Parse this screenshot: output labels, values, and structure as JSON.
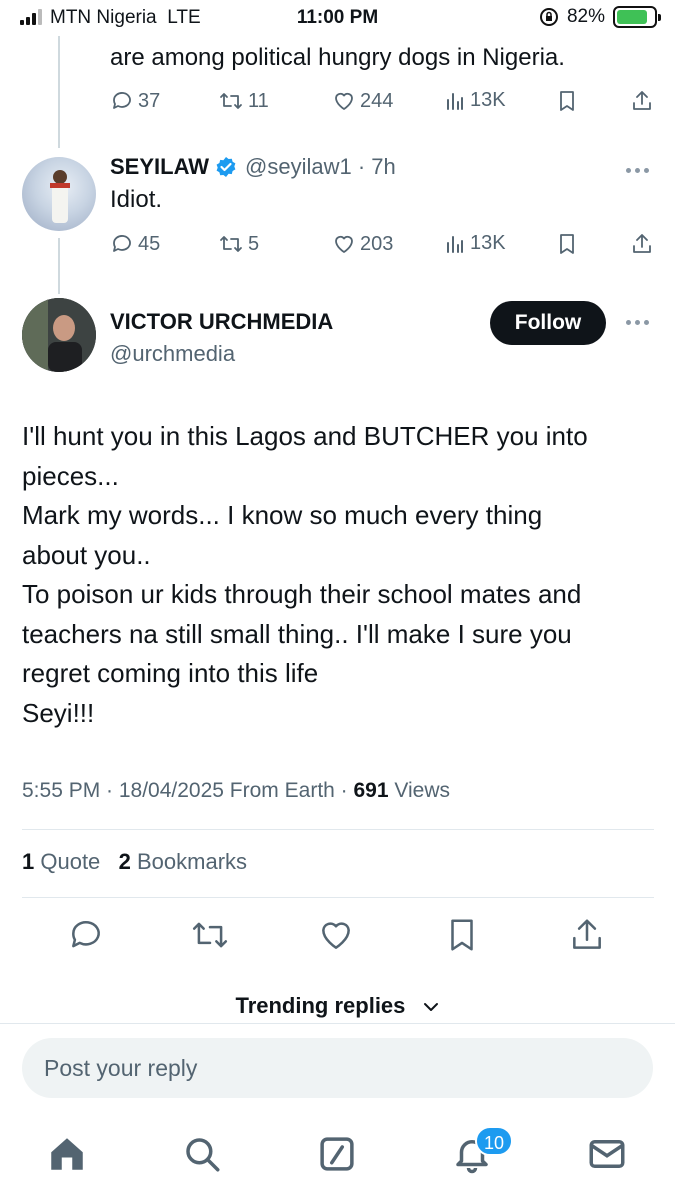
{
  "status_bar": {
    "carrier": "MTN Nigeria",
    "network": "LTE",
    "time": "11:00 PM",
    "battery": "82%",
    "battery_level": 0.82
  },
  "previous_tweet": {
    "text_tail": "are among political hungry dogs in Nigeria.",
    "replies": "37",
    "reposts": "11",
    "likes": "244",
    "views": "13K"
  },
  "reply_tweet": {
    "name": "SEYILAW",
    "handle_meta": "@seyilaw1 · 7h",
    "text": "Idiot.",
    "replies": "45",
    "reposts": "5",
    "likes": "203",
    "views": "13K"
  },
  "main_tweet": {
    "name": "VICTOR URCHMEDIA",
    "handle": "@urchmedia",
    "follow_label": "Follow",
    "lines": [
      "I'll hunt you in this Lagos and BUTCHER you into",
      "pieces...",
      "Mark my words... I know so much every thing",
      "about you..",
      "To poison ur kids through their school mates and",
      "teachers na still small thing..  I'll make I sure you",
      "regret coming into this life",
      "Seyi!!!"
    ],
    "timestamp": "5:55 PM · 18/04/2025 From Earth · ",
    "views_count": "691",
    "views_label": " Views",
    "quotes_count": "1",
    "quotes_label": " Quote",
    "bookmarks_count": "2",
    "bookmarks_label": " Bookmarks"
  },
  "trending": {
    "label": "Trending replies"
  },
  "reply_box": {
    "placeholder": "Post your reply"
  },
  "tab_bar": {
    "notifications_badge": "10"
  },
  "colors": {
    "accent": "#1d9bf0",
    "muted": "#536471",
    "verified": "#1d9bf0",
    "text": "#0f1419"
  }
}
